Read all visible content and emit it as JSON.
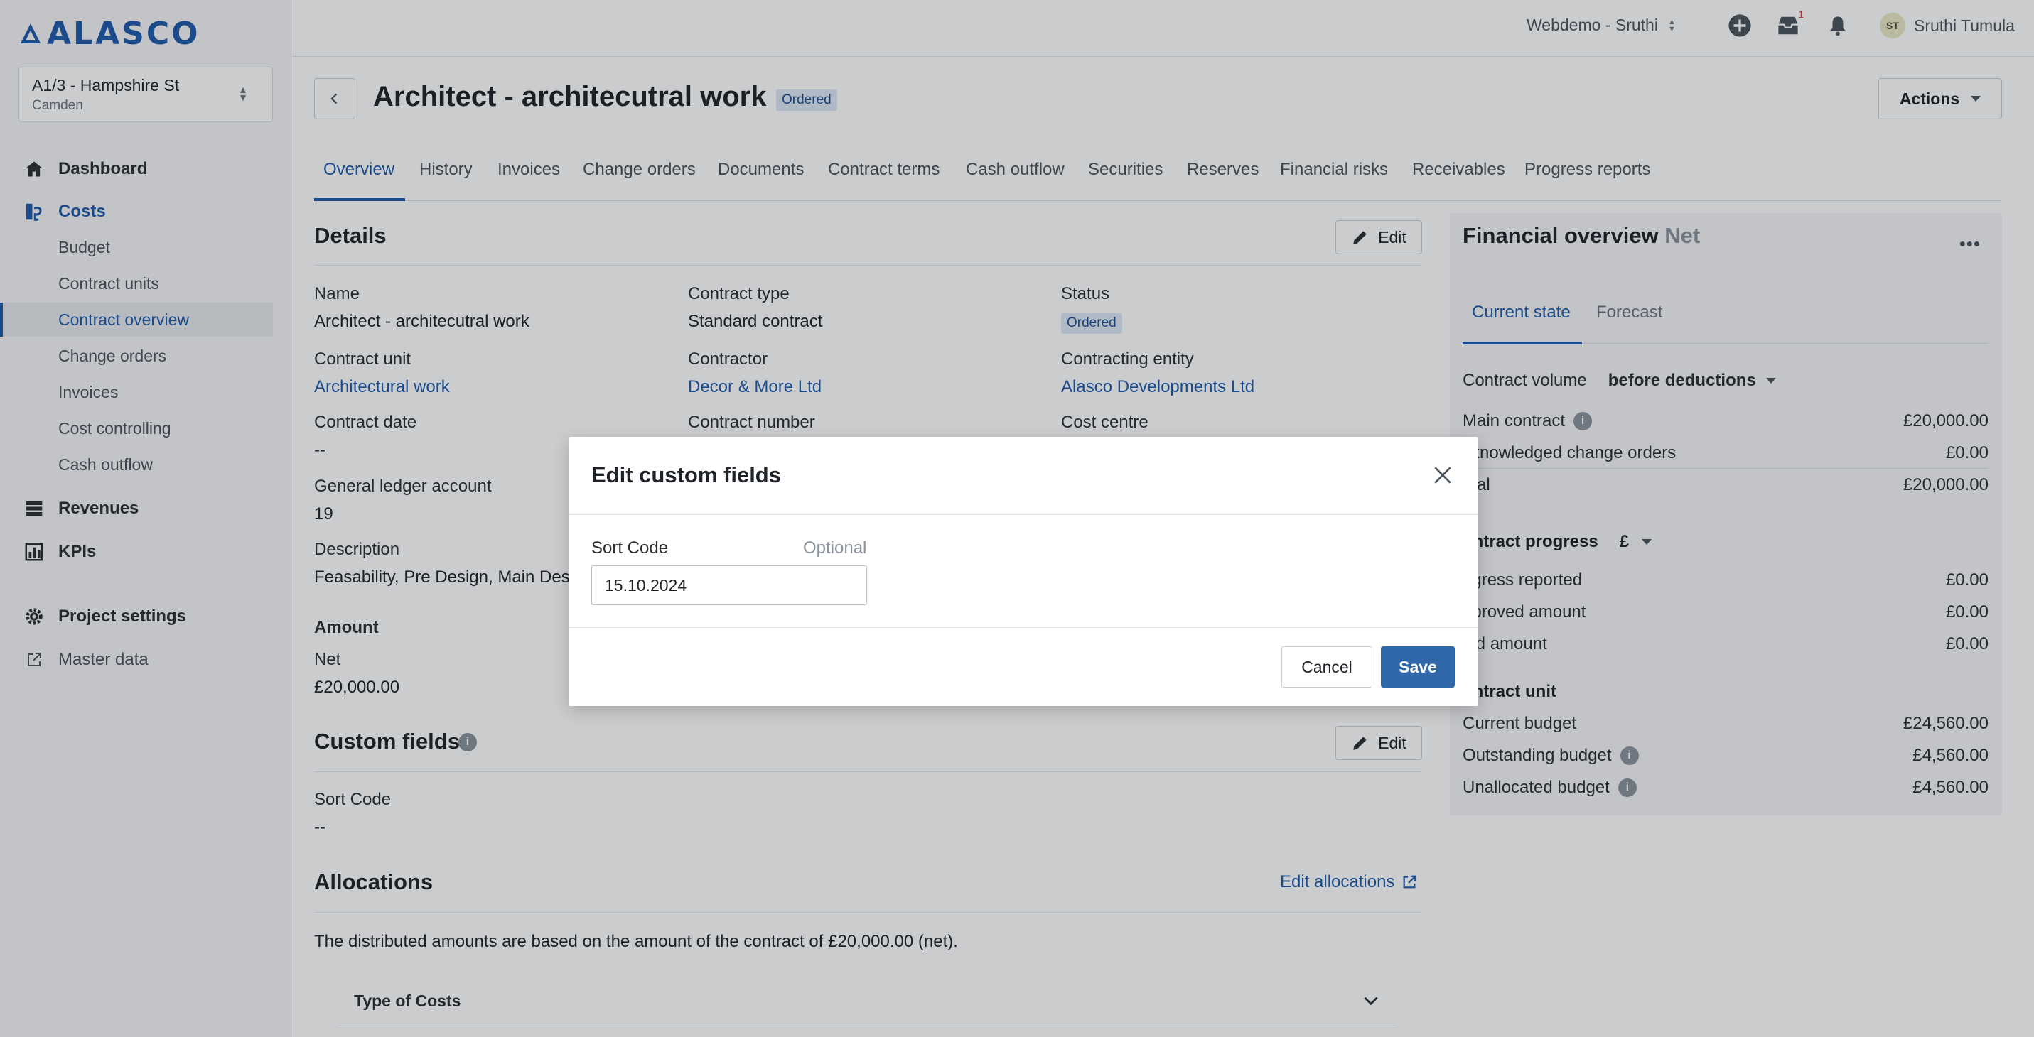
{
  "brand": {
    "logo_text": "ALASCO"
  },
  "project": {
    "name": "A1/3 - Hampshire St",
    "location": "Camden"
  },
  "sidebar": {
    "dashboard": "Dashboard",
    "costs": "Costs",
    "costs_items": [
      "Budget",
      "Contract units",
      "Contract overview",
      "Change orders",
      "Invoices",
      "Cost controlling",
      "Cash outflow"
    ],
    "revenues": "Revenues",
    "kpis": "KPIs",
    "project_settings": "Project settings",
    "master_data": "Master data"
  },
  "topbar": {
    "org": "Webdemo - Sruthi",
    "inbox_count": "1",
    "user_initials": "ST",
    "user_name": "Sruthi Tumula"
  },
  "header": {
    "title": "Architect - architecutral work",
    "status": "Ordered",
    "actions_label": "Actions"
  },
  "tabs": [
    "Overview",
    "History",
    "Invoices",
    "Change orders",
    "Documents",
    "Contract terms",
    "Cash outflow",
    "Securities",
    "Reserves",
    "Financial risks",
    "Receivables",
    "Progress reports"
  ],
  "details": {
    "title": "Details",
    "edit_label": "Edit",
    "name_label": "Name",
    "name_value": "Architect - architecutral work",
    "contract_type_label": "Contract type",
    "contract_type_value": "Standard contract",
    "status_label": "Status",
    "status_value": "Ordered",
    "contract_unit_label": "Contract unit",
    "contract_unit_value": "Architectural work",
    "contractor_label": "Contractor",
    "contractor_value": "Decor & More Ltd",
    "contracting_entity_label": "Contracting entity",
    "contracting_entity_value": "Alasco Developments Ltd",
    "contract_date_label": "Contract date",
    "contract_date_value": "--",
    "contract_number_label": "Contract number",
    "cost_centre_label": "Cost centre",
    "gl_account_label": "General ledger account",
    "gl_account_value": "19",
    "description_label": "Description",
    "description_value": "Feasability, Pre Design, Main Desi",
    "amount_label": "Amount",
    "net_label": "Net",
    "net_value": "£20,000.00"
  },
  "custom_fields": {
    "title": "Custom fields",
    "edit_label": "Edit",
    "sort_code_label": "Sort Code",
    "sort_code_value": "--"
  },
  "allocations": {
    "title": "Allocations",
    "edit_link": "Edit allocations",
    "note": "The distributed amounts are based on the amount of the contract of £20,000.00 (net).",
    "accordion_label": "Type of Costs"
  },
  "financial": {
    "title": "Financial overview",
    "title_suffix": "Net",
    "tabs": [
      "Current state",
      "Forecast"
    ],
    "volume_label": "Contract volume",
    "volume_mode": "before deductions",
    "main_contract_label": "Main contract",
    "main_contract_value": "£20,000.00",
    "ack_co_label": "cknowledged change orders",
    "ack_co_value": "£0.00",
    "total_label": "otal",
    "total_value": "£20,000.00",
    "progress_label": "ontract progress",
    "progress_currency": "£",
    "progress_reported_label": "ogress reported",
    "progress_reported_value": "£0.00",
    "approved_label": "pproved amount",
    "approved_value": "£0.00",
    "paid_label": "aid amount",
    "paid_value": "£0.00",
    "contract_unit_label": "ontract unit",
    "current_budget_label": "Current budget",
    "current_budget_value": "£24,560.00",
    "outstanding_label": "Outstanding budget",
    "outstanding_value": "£4,560.00",
    "unallocated_label": "Unallocated budget",
    "unallocated_value": "£4,560.00"
  },
  "modal": {
    "title": "Edit custom fields",
    "field_label": "Sort Code",
    "optional_label": "Optional",
    "field_value": "15.10.2024",
    "cancel_label": "Cancel",
    "save_label": "Save"
  },
  "colors": {
    "accent": "#1e5aa8",
    "save_button": "#2f67a8",
    "chip_bg": "#dde8f5"
  }
}
